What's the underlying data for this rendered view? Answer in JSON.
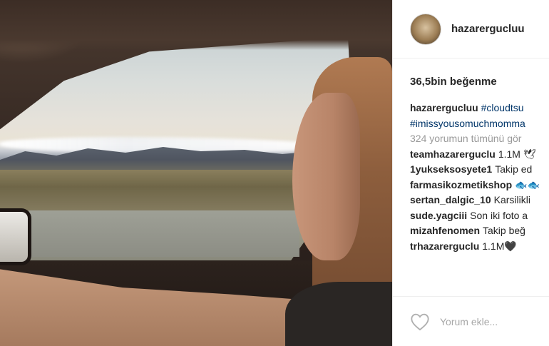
{
  "post": {
    "username": "hazarergucluu",
    "likes": "36,5bin beğenme",
    "caption": {
      "username": "hazarergucluu",
      "tag1": "#cloudtsu",
      "tag2": "#imissyousomuchmomma"
    },
    "view_all_comments": "324 yorumun tümünü gör",
    "comments": [
      {
        "user": "teamhazarerguclu",
        "text": "1.1M 🕊"
      },
      {
        "user": "1yukseksosyete1",
        "text": "Takip ed"
      },
      {
        "user": "farmasikozmetikshop",
        "text": "🐟🐟"
      },
      {
        "user": "sertan_dalgic_10",
        "text": "Karsilikli"
      },
      {
        "user": "sude.yagciii",
        "text": "Son iki foto a"
      },
      {
        "user": "mizahfenomen",
        "text": "Takip beğ"
      },
      {
        "user": "trhazarerguclu",
        "text": "1.1M🖤"
      }
    ],
    "comment_placeholder": "Yorum ekle...",
    "icons": {
      "like": "heart-outline-icon",
      "avatar": "profile-avatar"
    }
  }
}
